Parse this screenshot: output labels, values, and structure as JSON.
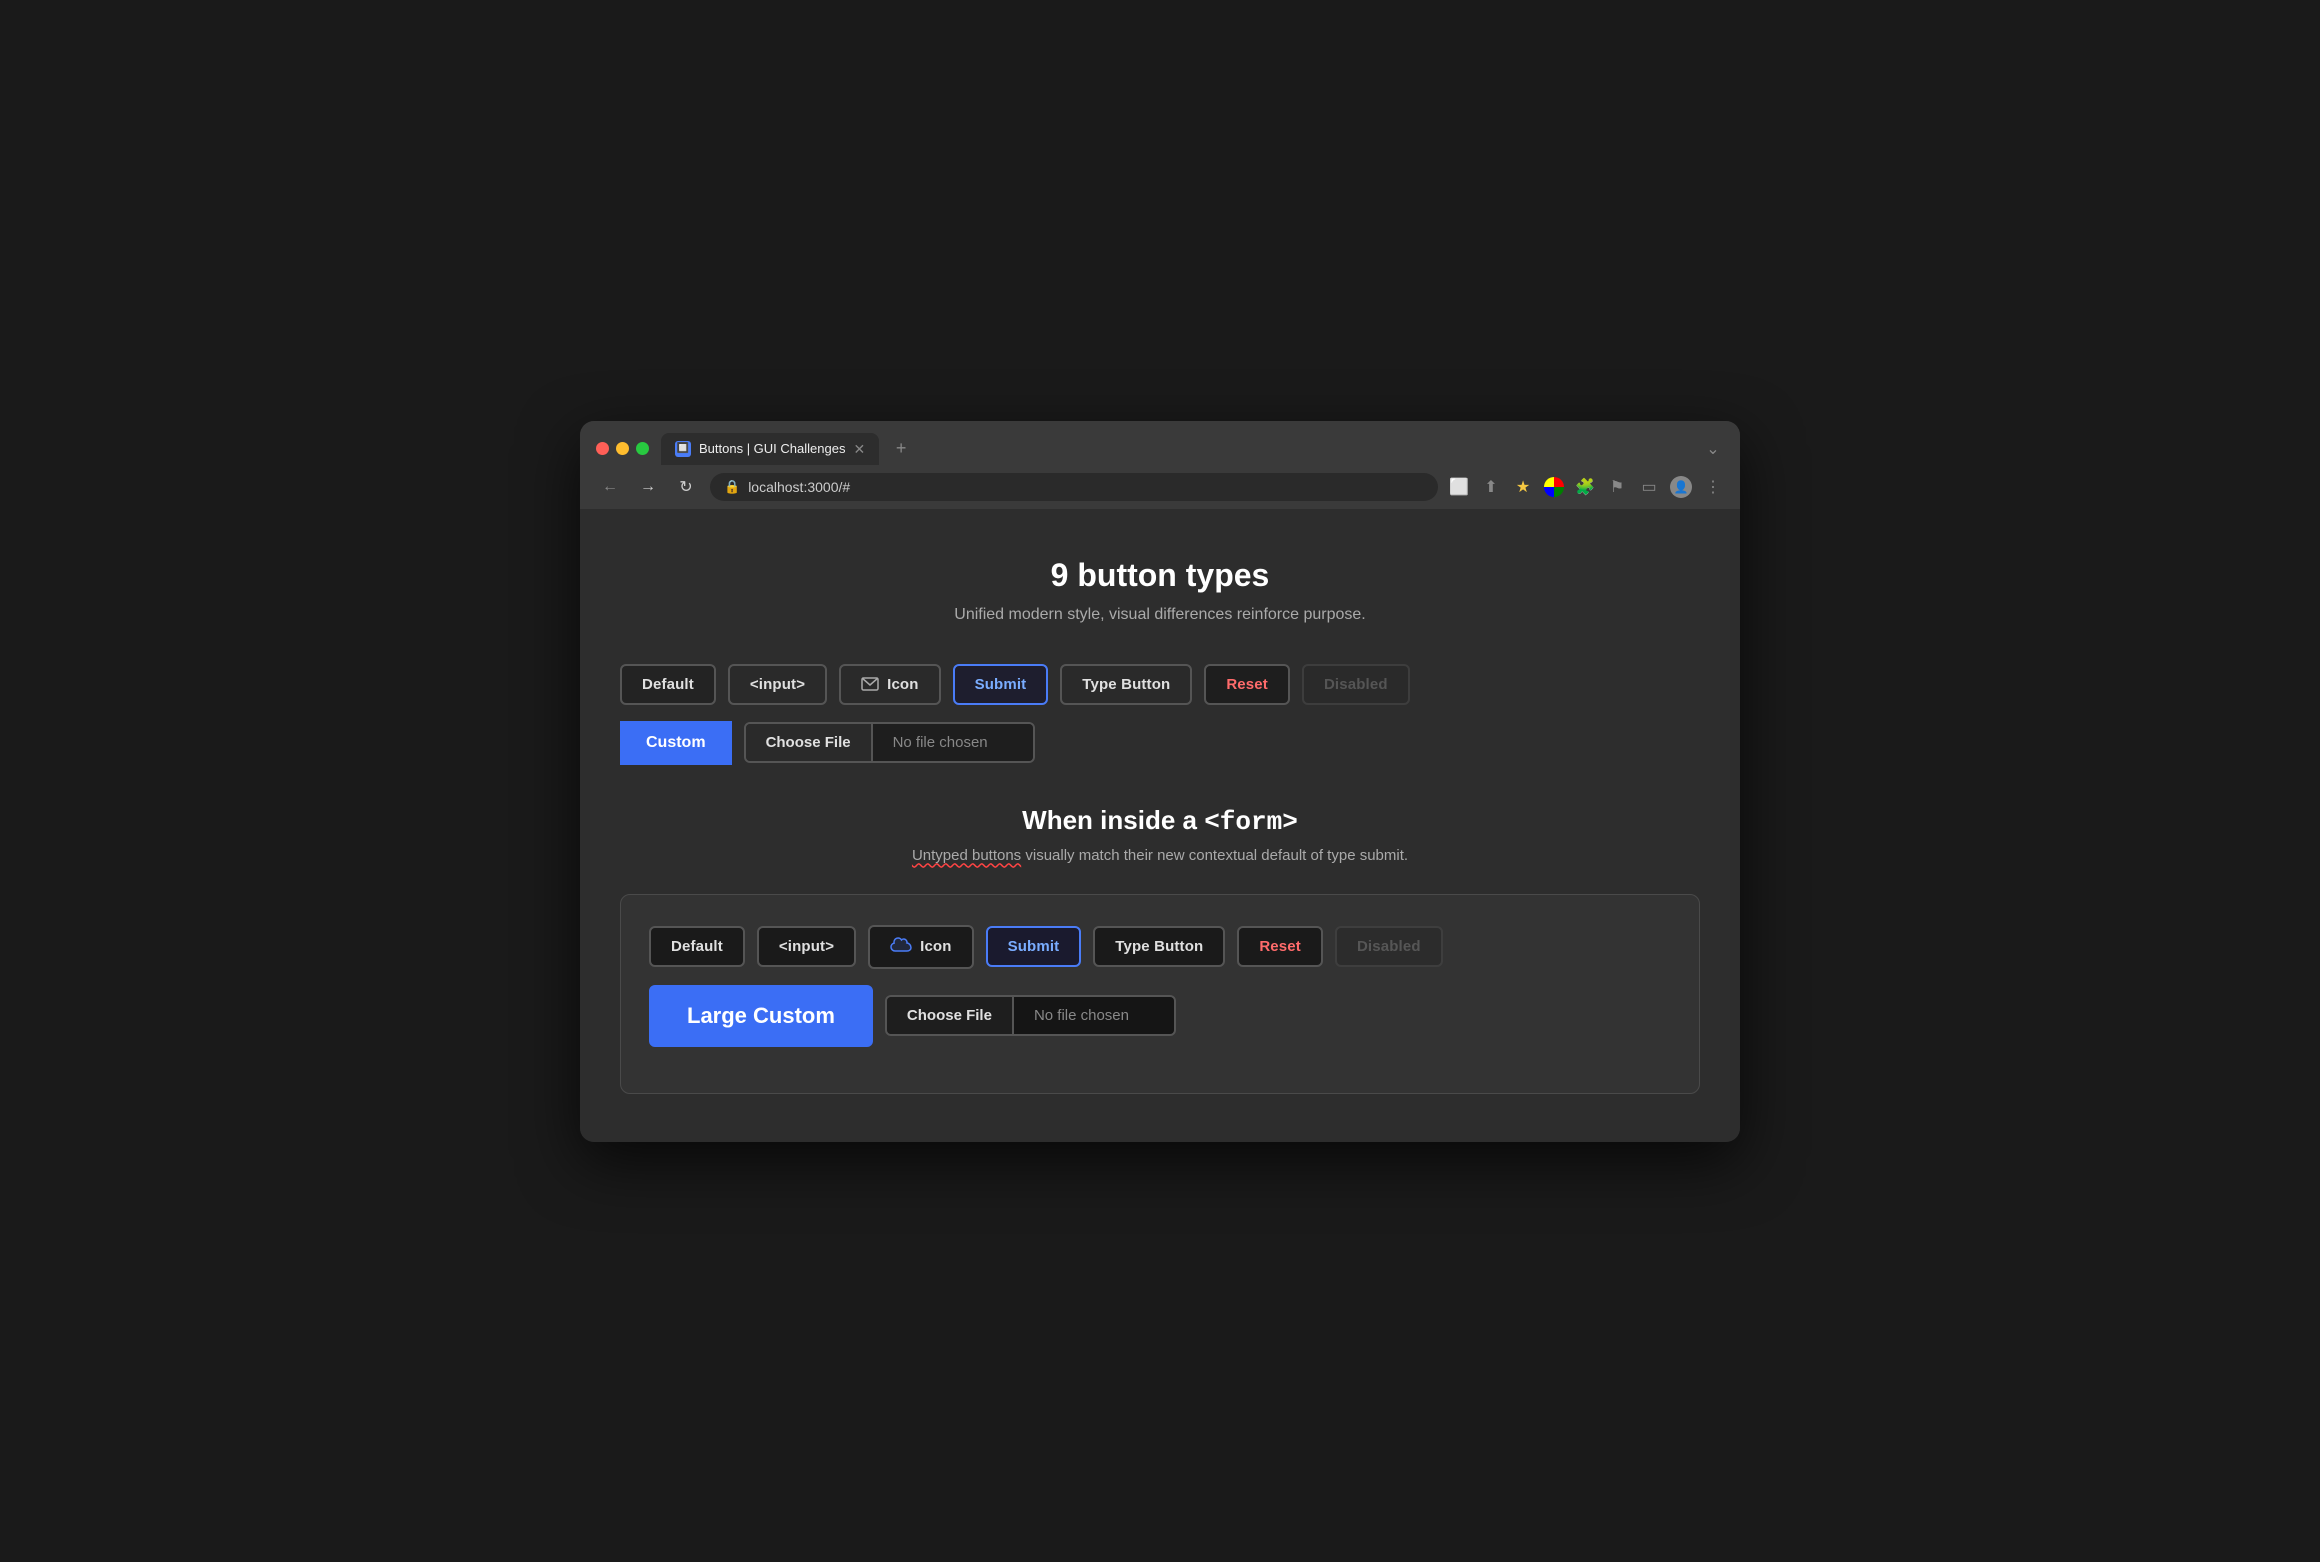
{
  "browser": {
    "tab_title": "Buttons | GUI Challenges",
    "address": "localhost:3000/#",
    "new_tab_label": "+"
  },
  "page": {
    "title": "9 button types",
    "subtitle": "Unified modern style, visual differences reinforce purpose.",
    "section2_heading_text": "When inside a ",
    "section2_heading_code": "<form>",
    "section2_subtitle_part1": "Untyped buttons",
    "section2_subtitle_part2": " visually match their new contextual default of type submit."
  },
  "row1": {
    "default_label": "Default",
    "input_label": "<input>",
    "icon_label": "Icon",
    "submit_label": "Submit",
    "type_button_label": "Type Button",
    "reset_label": "Reset",
    "disabled_label": "Disabled"
  },
  "row2": {
    "custom_label": "Custom",
    "choose_file_label": "Choose File",
    "no_file_label": "No file chosen"
  },
  "row3": {
    "default_label": "Default",
    "input_label": "<input>",
    "icon_label": "Icon",
    "submit_label": "Submit",
    "type_button_label": "Type Button",
    "reset_label": "Reset",
    "disabled_label": "Disabled"
  },
  "row4": {
    "large_custom_label": "Large Custom",
    "choose_file_label": "Choose File",
    "no_file_label": "No file chosen"
  }
}
